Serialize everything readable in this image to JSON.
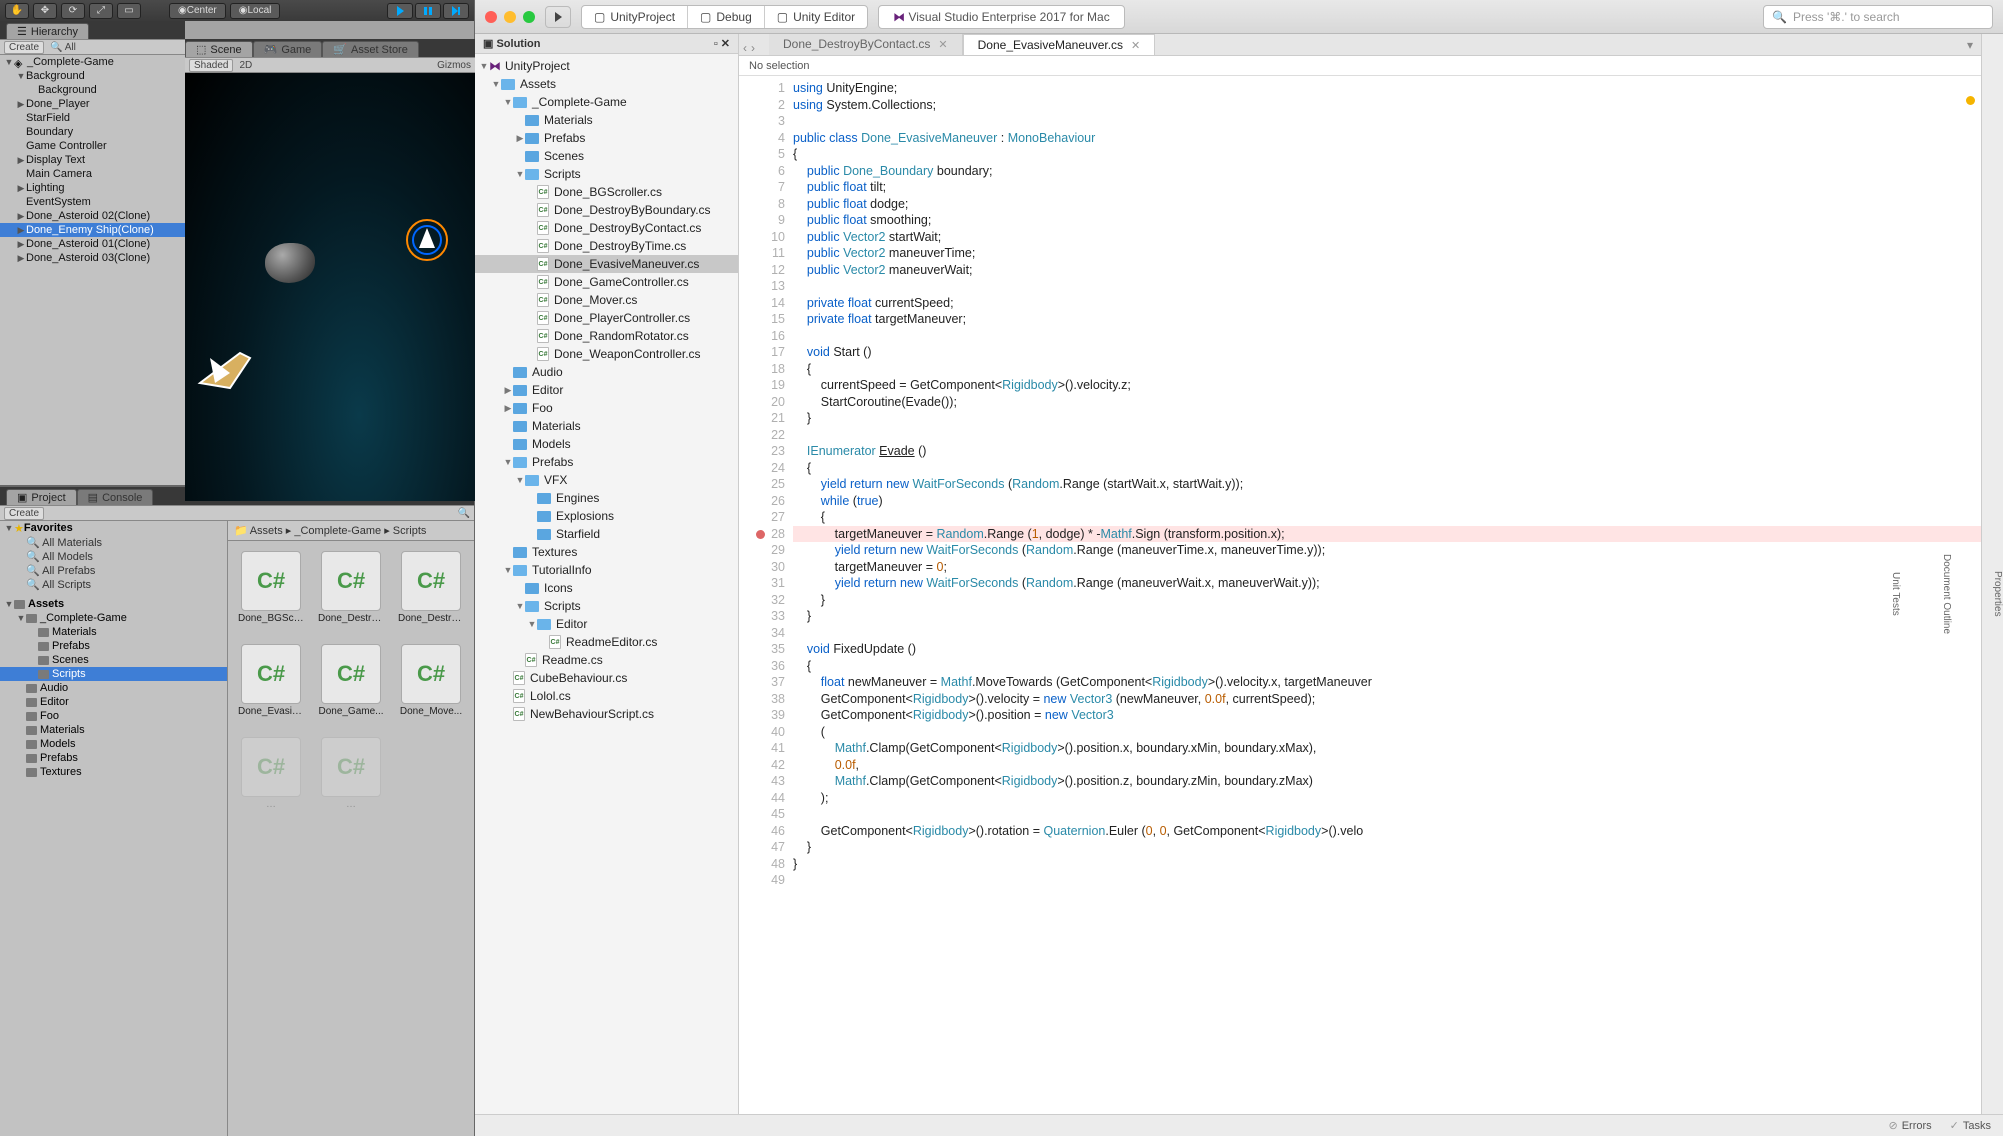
{
  "unity": {
    "toolbar": {
      "center": "Center",
      "local": "Local"
    },
    "tabs": {
      "hierarchy": "Hierarchy",
      "scene": "Scene",
      "game": "Game",
      "asset_store": "Asset Store",
      "project": "Project",
      "console": "Console"
    },
    "hier_sub": {
      "create": "Create",
      "search": "All"
    },
    "scene_sub": {
      "shading": "Shaded",
      "mode": "2D",
      "gizmos": "Gizmos"
    },
    "hierarchy": [
      {
        "d": 0,
        "exp": "▼",
        "t": "_Complete-Game",
        "cube": 1
      },
      {
        "d": 1,
        "exp": "▼",
        "t": "Background"
      },
      {
        "d": 2,
        "t": "Background"
      },
      {
        "d": 1,
        "exp": "▶",
        "t": "Done_Player"
      },
      {
        "d": 1,
        "t": "StarField"
      },
      {
        "d": 1,
        "t": "Boundary"
      },
      {
        "d": 1,
        "t": "Game Controller"
      },
      {
        "d": 1,
        "exp": "▶",
        "t": "Display Text"
      },
      {
        "d": 1,
        "t": "Main Camera"
      },
      {
        "d": 1,
        "exp": "▶",
        "t": "Lighting"
      },
      {
        "d": 1,
        "t": "EventSystem"
      },
      {
        "d": 1,
        "exp": "▶",
        "t": "Done_Asteroid 02(Clone)"
      },
      {
        "d": 1,
        "exp": "▶",
        "t": "Done_Enemy Ship(Clone)",
        "sel": 1
      },
      {
        "d": 1,
        "exp": "▶",
        "t": "Done_Asteroid 01(Clone)"
      },
      {
        "d": 1,
        "exp": "▶",
        "t": "Done_Asteroid 03(Clone)"
      }
    ],
    "proj_sub": {
      "create": "Create"
    },
    "favorites_label": "Favorites",
    "favorites": [
      "All Materials",
      "All Models",
      "All Prefabs",
      "All Scripts"
    ],
    "assets_label": "Assets",
    "proj_tree": [
      {
        "d": 1,
        "exp": "▼",
        "t": "_Complete-Game"
      },
      {
        "d": 2,
        "t": "Materials"
      },
      {
        "d": 2,
        "t": "Prefabs"
      },
      {
        "d": 2,
        "t": "Scenes"
      },
      {
        "d": 2,
        "t": "Scripts",
        "sel": 1
      },
      {
        "d": 1,
        "t": "Audio"
      },
      {
        "d": 1,
        "t": "Editor"
      },
      {
        "d": 1,
        "t": "Foo"
      },
      {
        "d": 1,
        "t": "Materials"
      },
      {
        "d": 1,
        "t": "Models"
      },
      {
        "d": 1,
        "t": "Prefabs"
      },
      {
        "d": 1,
        "t": "Textures"
      }
    ],
    "breadcrumb": [
      "Assets",
      "_Complete-Game",
      "Scripts"
    ],
    "assets": [
      "Done_BGScro...",
      "Done_Destro...",
      "Done_Destro...",
      "Done_Evasiv...",
      "Done_Game...",
      "Done_Move..."
    ]
  },
  "vs": {
    "crumbs": {
      "project": "UnityProject",
      "config": "Debug",
      "target": "Unity Editor",
      "ide": "Visual Studio Enterprise 2017 for Mac"
    },
    "search_placeholder": "Press '⌘.' to search",
    "solution_label": "Solution",
    "sol_tree": [
      {
        "d": 0,
        "exp": "▼",
        "t": "UnityProject",
        "k": "sln"
      },
      {
        "d": 1,
        "exp": "▼",
        "t": "Assets",
        "k": "f"
      },
      {
        "d": 2,
        "exp": "▼",
        "t": "_Complete-Game",
        "k": "f"
      },
      {
        "d": 3,
        "t": "Materials",
        "k": "f"
      },
      {
        "d": 3,
        "exp": "▶",
        "t": "Prefabs",
        "k": "f"
      },
      {
        "d": 3,
        "t": "Scenes",
        "k": "f"
      },
      {
        "d": 3,
        "exp": "▼",
        "t": "Scripts",
        "k": "f"
      },
      {
        "d": 4,
        "t": "Done_BGScroller.cs",
        "k": "cs"
      },
      {
        "d": 4,
        "t": "Done_DestroyByBoundary.cs",
        "k": "cs"
      },
      {
        "d": 4,
        "t": "Done_DestroyByContact.cs",
        "k": "cs"
      },
      {
        "d": 4,
        "t": "Done_DestroyByTime.cs",
        "k": "cs"
      },
      {
        "d": 4,
        "t": "Done_EvasiveManeuver.cs",
        "k": "cs",
        "sel": 1
      },
      {
        "d": 4,
        "t": "Done_GameController.cs",
        "k": "cs"
      },
      {
        "d": 4,
        "t": "Done_Mover.cs",
        "k": "cs"
      },
      {
        "d": 4,
        "t": "Done_PlayerController.cs",
        "k": "cs"
      },
      {
        "d": 4,
        "t": "Done_RandomRotator.cs",
        "k": "cs"
      },
      {
        "d": 4,
        "t": "Done_WeaponController.cs",
        "k": "cs"
      },
      {
        "d": 2,
        "t": "Audio",
        "k": "f"
      },
      {
        "d": 2,
        "exp": "▶",
        "t": "Editor",
        "k": "f"
      },
      {
        "d": 2,
        "exp": "▶",
        "t": "Foo",
        "k": "f"
      },
      {
        "d": 2,
        "t": "Materials",
        "k": "f"
      },
      {
        "d": 2,
        "t": "Models",
        "k": "f"
      },
      {
        "d": 2,
        "exp": "▼",
        "t": "Prefabs",
        "k": "f"
      },
      {
        "d": 3,
        "exp": "▼",
        "t": "VFX",
        "k": "f"
      },
      {
        "d": 4,
        "t": "Engines",
        "k": "f"
      },
      {
        "d": 4,
        "t": "Explosions",
        "k": "f"
      },
      {
        "d": 4,
        "t": "Starfield",
        "k": "f"
      },
      {
        "d": 2,
        "t": "Textures",
        "k": "f"
      },
      {
        "d": 2,
        "exp": "▼",
        "t": "TutorialInfo",
        "k": "f"
      },
      {
        "d": 3,
        "t": "Icons",
        "k": "f"
      },
      {
        "d": 3,
        "exp": "▼",
        "t": "Scripts",
        "k": "f"
      },
      {
        "d": 4,
        "exp": "▼",
        "t": "Editor",
        "k": "f"
      },
      {
        "d": 5,
        "t": "ReadmeEditor.cs",
        "k": "cs"
      },
      {
        "d": 3,
        "t": "Readme.cs",
        "k": "cs"
      },
      {
        "d": 2,
        "t": "CubeBehaviour.cs",
        "k": "cs"
      },
      {
        "d": 2,
        "t": "Lolol.cs",
        "k": "cs"
      },
      {
        "d": 2,
        "t": "NewBehaviourScript.cs",
        "k": "cs"
      }
    ],
    "tabs": [
      {
        "t": "Done_DestroyByContact.cs",
        "active": 0
      },
      {
        "t": "Done_EvasiveManeuver.cs",
        "active": 1
      }
    ],
    "path_crumb": "No selection",
    "code_lines": [
      {
        "n": 1,
        "h": "<span class='kw'>using</span> UnityEngine;"
      },
      {
        "n": 2,
        "h": "<span class='kw'>using</span> System.Collections;"
      },
      {
        "n": 3,
        "h": ""
      },
      {
        "n": 4,
        "h": "<span class='kw'>public class</span> <span class='ty'>Done_EvasiveManeuver</span> : <span class='ty'>MonoBehaviour</span>"
      },
      {
        "n": 5,
        "h": "{"
      },
      {
        "n": 6,
        "h": "    <span class='kw'>public</span> <span class='ty'>Done_Boundary</span> boundary;"
      },
      {
        "n": 7,
        "h": "    <span class='kw'>public</span> <span class='kw'>float</span> tilt;"
      },
      {
        "n": 8,
        "h": "    <span class='kw'>public</span> <span class='kw'>float</span> dodge;"
      },
      {
        "n": 9,
        "h": "    <span class='kw'>public</span> <span class='kw'>float</span> smoothing;"
      },
      {
        "n": 10,
        "h": "    <span class='kw'>public</span> <span class='ty'>Vector2</span> startWait;"
      },
      {
        "n": 11,
        "h": "    <span class='kw'>public</span> <span class='ty'>Vector2</span> maneuverTime;"
      },
      {
        "n": 12,
        "h": "    <span class='kw'>public</span> <span class='ty'>Vector2</span> maneuverWait;"
      },
      {
        "n": 13,
        "h": ""
      },
      {
        "n": 14,
        "h": "    <span class='kw'>private</span> <span class='kw'>float</span> currentSpeed;"
      },
      {
        "n": 15,
        "h": "    <span class='kw'>private</span> <span class='kw'>float</span> targetManeuver;"
      },
      {
        "n": 16,
        "h": ""
      },
      {
        "n": 17,
        "h": "    <span class='kw'>void</span> Start ()"
      },
      {
        "n": 18,
        "h": "    {"
      },
      {
        "n": 19,
        "h": "        currentSpeed = GetComponent&lt;<span class='ty'>Rigidbody</span>&gt;().velocity.z;"
      },
      {
        "n": 20,
        "h": "        StartCoroutine(Evade());"
      },
      {
        "n": 21,
        "h": "    }"
      },
      {
        "n": 22,
        "h": ""
      },
      {
        "n": 23,
        "h": "    <span class='ty'>IEnumerator</span> <span style='text-decoration:underline'>Evade</span> ()"
      },
      {
        "n": 24,
        "h": "    {"
      },
      {
        "n": 25,
        "h": "        <span class='kw'>yield return new</span> <span class='ty'>WaitForSeconds</span> (<span class='ty'>Random</span>.Range (startWait.x, startWait.y));"
      },
      {
        "n": 26,
        "h": "        <span class='kw'>while</span> (<span class='kw'>true</span>)"
      },
      {
        "n": 27,
        "h": "        {"
      },
      {
        "n": 28,
        "bp": 1,
        "hl": 1,
        "h": "            targetManeuver = <span class='ty'>Random</span>.Range (<span class='num'>1</span>, dodge) * -<span class='ty'>Mathf</span>.Sign (transform.position.x);"
      },
      {
        "n": 29,
        "h": "            <span class='kw'>yield return new</span> <span class='ty'>WaitForSeconds</span> (<span class='ty'>Random</span>.Range (maneuverTime.x, maneuverTime.y));"
      },
      {
        "n": 30,
        "h": "            targetManeuver = <span class='num'>0</span>;"
      },
      {
        "n": 31,
        "h": "            <span class='kw'>yield return new</span> <span class='ty'>WaitForSeconds</span> (<span class='ty'>Random</span>.Range (maneuverWait.x, maneuverWait.y));"
      },
      {
        "n": 32,
        "h": "        }"
      },
      {
        "n": 33,
        "h": "    }"
      },
      {
        "n": 34,
        "h": ""
      },
      {
        "n": 35,
        "h": "    <span class='kw'>void</span> FixedUpdate ()"
      },
      {
        "n": 36,
        "h": "    {"
      },
      {
        "n": 37,
        "h": "        <span class='kw'>float</span> newManeuver = <span class='ty'>Mathf</span>.MoveTowards (GetComponent&lt;<span class='ty'>Rigidbody</span>&gt;().velocity.x, targetManeuver"
      },
      {
        "n": 38,
        "h": "        GetComponent&lt;<span class='ty'>Rigidbody</span>&gt;().velocity = <span class='kw'>new</span> <span class='ty'>Vector3</span> (newManeuver, <span class='num'>0.0f</span>, currentSpeed);"
      },
      {
        "n": 39,
        "h": "        GetComponent&lt;<span class='ty'>Rigidbody</span>&gt;().position = <span class='kw'>new</span> <span class='ty'>Vector3</span>"
      },
      {
        "n": 40,
        "h": "        ("
      },
      {
        "n": 41,
        "h": "            <span class='ty'>Mathf</span>.Clamp(GetComponent&lt;<span class='ty'>Rigidbody</span>&gt;().position.x, boundary.xMin, boundary.xMax),"
      },
      {
        "n": 42,
        "h": "            <span class='num'>0.0f</span>,"
      },
      {
        "n": 43,
        "h": "            <span class='ty'>Mathf</span>.Clamp(GetComponent&lt;<span class='ty'>Rigidbody</span>&gt;().position.z, boundary.zMin, boundary.zMax)"
      },
      {
        "n": 44,
        "h": "        );"
      },
      {
        "n": 45,
        "h": ""
      },
      {
        "n": 46,
        "h": "        GetComponent&lt;<span class='ty'>Rigidbody</span>&gt;().rotation = <span class='ty'>Quaternion</span>.Euler (<span class='num'>0</span>, <span class='num'>0</span>, GetComponent&lt;<span class='ty'>Rigidbody</span>&gt;().velo"
      },
      {
        "n": 47,
        "h": "    }"
      },
      {
        "n": 48,
        "h": "}"
      },
      {
        "n": 49,
        "h": ""
      }
    ],
    "right_rail": [
      "Properties",
      "Document Outline",
      "Unit Tests"
    ],
    "status": {
      "errors": "Errors",
      "tasks": "Tasks"
    }
  }
}
